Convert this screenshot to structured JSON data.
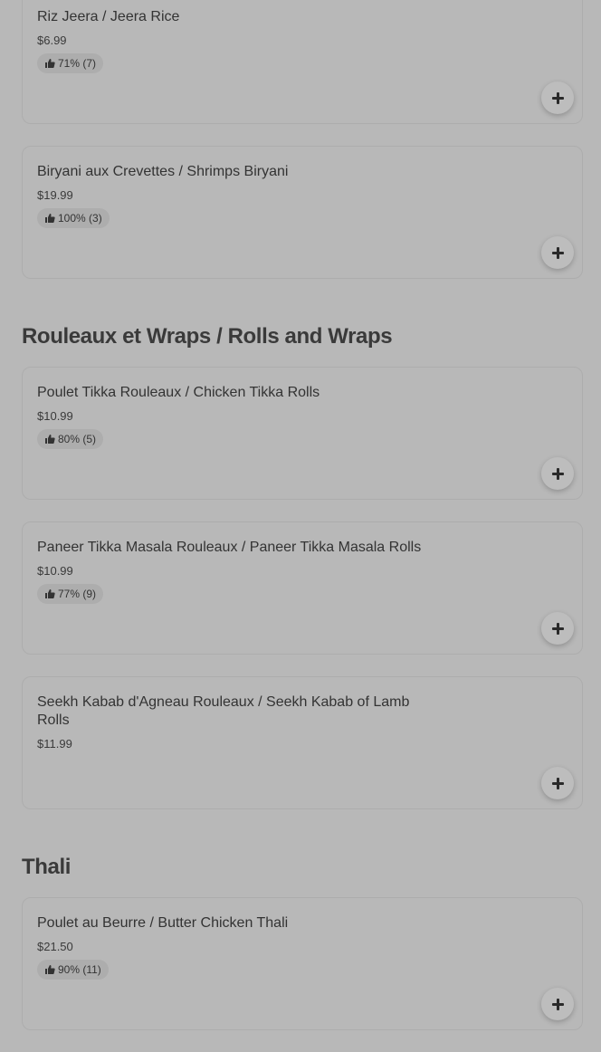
{
  "sections": [
    {
      "heading": "",
      "items": [
        {
          "name": "Riz Jeera / Jeera Rice",
          "price": "$6.99",
          "rating": "71% (7)"
        },
        {
          "name": "Biryani aux Crevettes / Shrimps Biryani",
          "price": "$19.99",
          "rating": "100% (3)"
        }
      ]
    },
    {
      "heading": "Rouleaux et Wraps / Rolls and Wraps",
      "items": [
        {
          "name": "Poulet Tikka Rouleaux / Chicken Tikka Rolls",
          "price": "$10.99",
          "rating": "80% (5)"
        },
        {
          "name": "Paneer Tikka Masala Rouleaux / Paneer Tikka Masala Rolls",
          "price": "$10.99",
          "rating": "77% (9)"
        },
        {
          "name": "Seekh Kabab d'Agneau Rouleaux / Seekh Kabab of Lamb Rolls",
          "price": "$11.99",
          "rating": ""
        }
      ]
    },
    {
      "heading": "Thali",
      "items": [
        {
          "name": "Poulet au Beurre / Butter Chicken Thali",
          "price": "$21.50",
          "rating": "90% (11)"
        }
      ]
    }
  ],
  "icons": {
    "rating": "thumbs-up-icon",
    "add": "plus-icon"
  }
}
